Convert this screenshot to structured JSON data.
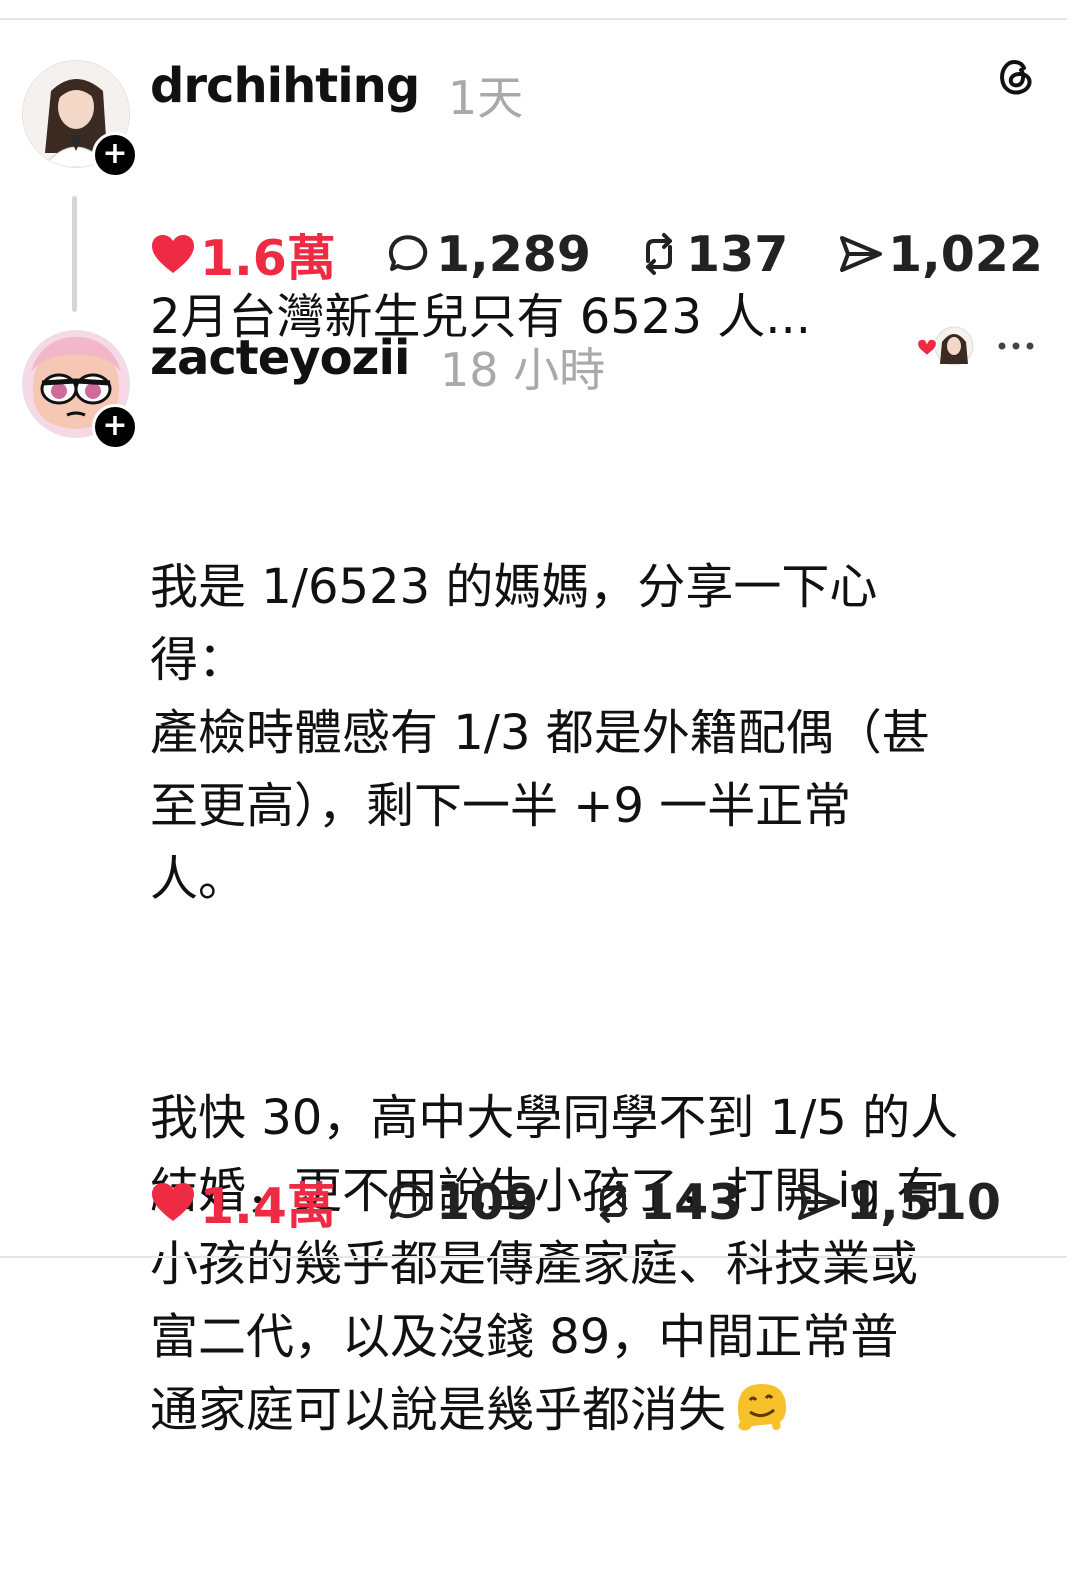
{
  "posts": [
    {
      "username": "drchihting",
      "time": "1天",
      "text": [
        "2月台灣新生兒只有 6523 人..."
      ],
      "stats": {
        "likes": "1.6萬",
        "comments": "1,289",
        "reposts": "137",
        "shares": "1,022"
      }
    },
    {
      "username": "zacteyozii",
      "time": "18 小時",
      "text": [
        "我是 1/6523 的媽媽，分享一下心\n得：\n產檢時體感有 1/3 都是外籍配偶（甚\n至更高），剩下一半 +9 一半正常\n人。",
        "我快 30，高中大學同學不到 1/5 的人\n結婚，更不用說生小孩了，打開 ig 有\n小孩的幾乎都是傳產家庭、科技業或\n富二代，以及沒錢 89，中間正常普\n通家庭可以說是幾乎都消失"
      ],
      "stats": {
        "likes": "1.4萬",
        "comments": "109",
        "reposts": "143",
        "shares": "1,510"
      }
    }
  ],
  "icons": {
    "like": "heart-icon",
    "comment": "comment-bubble-icon",
    "repost": "repost-icon",
    "share": "send-icon",
    "logo": "threads-logo-icon",
    "more": "more-dots-icon",
    "emoji": "melting-face-emoji"
  },
  "colors": {
    "like": "#ef2b43",
    "muted": "#a9a9a9",
    "text": "#111111"
  }
}
